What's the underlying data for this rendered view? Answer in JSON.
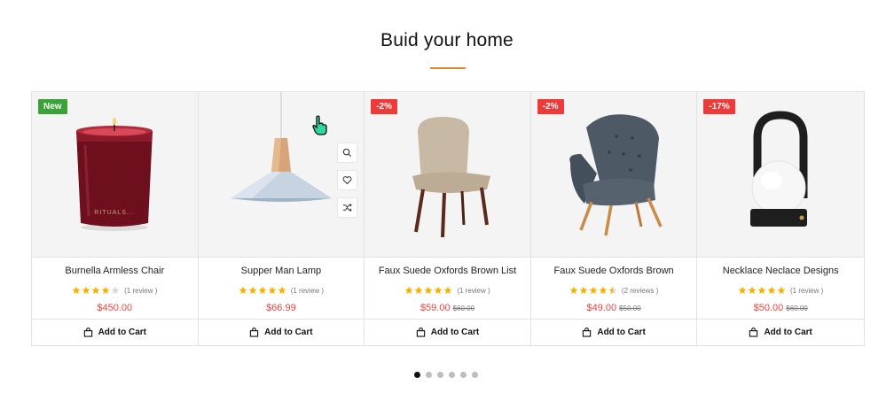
{
  "section": {
    "title": "Buid your home"
  },
  "products": [
    {
      "name": "Burnella Armless Chair",
      "rating": 4,
      "reviews": "(1  review )",
      "price": "$450.00",
      "old_price": "",
      "badge": "New",
      "badge_type": "new",
      "cart_label": "Add to Cart"
    },
    {
      "name": "Supper Man Lamp",
      "rating": 5,
      "reviews": "(1  review )",
      "price": "$66.99",
      "old_price": "",
      "badge": "",
      "badge_type": "",
      "cart_label": "Add to Cart"
    },
    {
      "name": "Faux Suede Oxfords Brown List",
      "rating": 5,
      "reviews": "(1  review )",
      "price": "$59.00",
      "old_price": "$60.00",
      "badge": "-2%",
      "badge_type": "sale",
      "cart_label": "Add to Cart"
    },
    {
      "name": "Faux Suede Oxfords Brown",
      "rating": 4.5,
      "reviews": "(2  reviews )",
      "price": "$49.00",
      "old_price": "$50.00",
      "badge": "-2%",
      "badge_type": "sale",
      "cart_label": "Add to Cart"
    },
    {
      "name": "Necklace Neclace Designs",
      "rating": 5,
      "reviews": "(1  review )",
      "price": "$50.00",
      "old_price": "$60.00",
      "badge": "-17%",
      "badge_type": "sale",
      "cart_label": "Add to Cart"
    }
  ],
  "quick_actions": [
    "search-icon",
    "heart-icon",
    "shuffle-icon"
  ],
  "candle_label": "RITUALS...",
  "pagination": {
    "count": 6,
    "active": 0
  },
  "colors": {
    "accent": "#d9892b",
    "price": "#e84545",
    "star": "#f5b301",
    "badge_new": "#3aa335",
    "badge_sale": "#ef3a3a"
  }
}
